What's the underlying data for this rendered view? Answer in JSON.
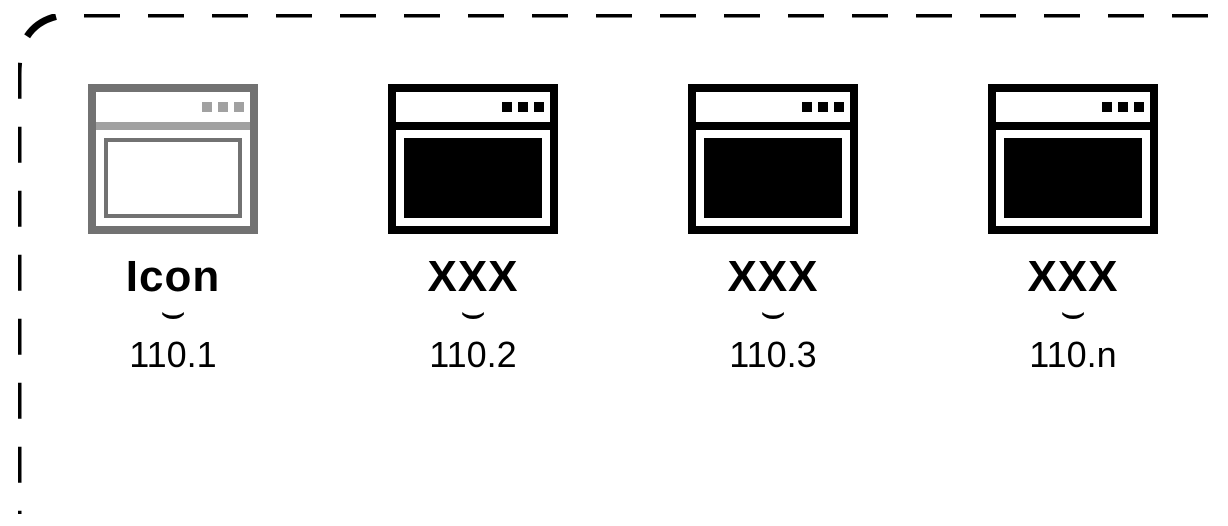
{
  "diagram": {
    "items": [
      {
        "name": "Icon",
        "ref": "110.1",
        "filled": false,
        "active": false
      },
      {
        "name": "XXX",
        "ref": "110.2",
        "filled": true,
        "active": true
      },
      {
        "name": "XXX",
        "ref": "110.3",
        "filled": true,
        "active": true
      },
      {
        "name": "XXX",
        "ref": "110.n",
        "filled": true,
        "active": true
      }
    ]
  }
}
